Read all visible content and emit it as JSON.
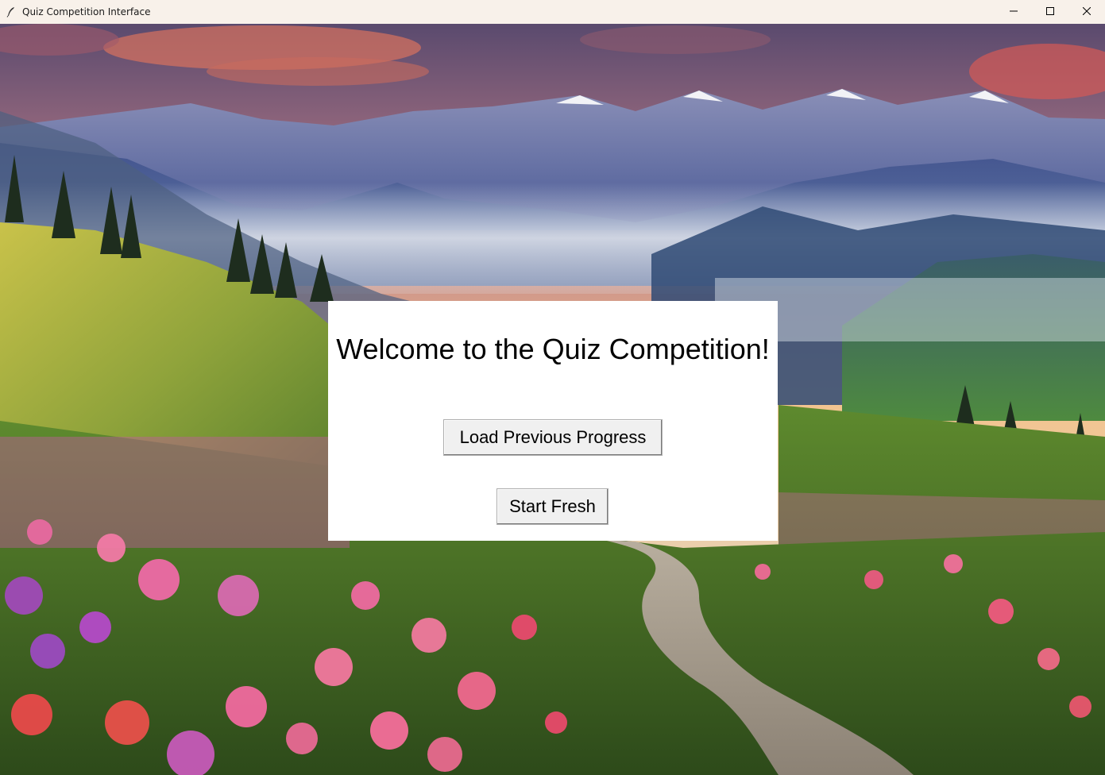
{
  "window": {
    "title": "Quiz Competition Interface",
    "icon": "feather-icon",
    "controls": [
      "minimize-icon",
      "maximize-icon",
      "close-icon"
    ]
  },
  "background": {
    "description_icon": "landscape-image"
  },
  "main": {
    "welcome_text": "Welcome to the Quiz Competition!",
    "load_button_label": "Load Previous Progress",
    "fresh_button_label": "Start Fresh"
  },
  "colors": {
    "titlebar": "#f8f1ea",
    "panel": "#ffffff",
    "button": "#f0f0f0"
  }
}
